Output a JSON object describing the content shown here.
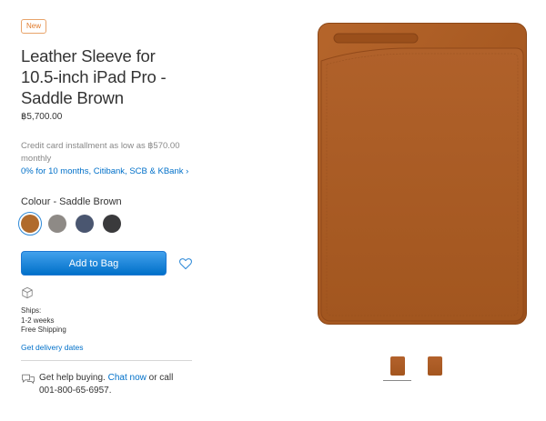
{
  "product": {
    "badge": "New",
    "title": "Leather Sleeve for 10.5-inch iPad Pro - Saddle Brown",
    "price": "฿5,700.00",
    "installment_text": "Credit card installment as low as ฿570.00 monthly",
    "installment_link": "0% for 10 months, Citibank, SCB & KBank ›"
  },
  "colour": {
    "label": "Colour - Saddle Brown",
    "swatches": [
      {
        "name": "Saddle Brown",
        "color": "#b06a2c",
        "selected": true
      },
      {
        "name": "Taupe",
        "color": "#8e8a86",
        "selected": false
      },
      {
        "name": "Midnight Blue",
        "color": "#4a5670",
        "selected": false
      },
      {
        "name": "Black",
        "color": "#3a3a3c",
        "selected": false
      }
    ]
  },
  "actions": {
    "add_to_bag": "Add to Bag"
  },
  "shipping": {
    "line1": "Ships:",
    "line2": "1-2 weeks",
    "line3": "Free Shipping",
    "delivery_link": "Get delivery dates"
  },
  "help": {
    "prefix": "Get help buying.",
    "chat_link": "Chat now",
    "suffix": "or call",
    "phone": "001-800-65-6957."
  },
  "colors": {
    "link": "#0070c9",
    "leather": "#a4561f",
    "badge": "#e07a2a"
  }
}
